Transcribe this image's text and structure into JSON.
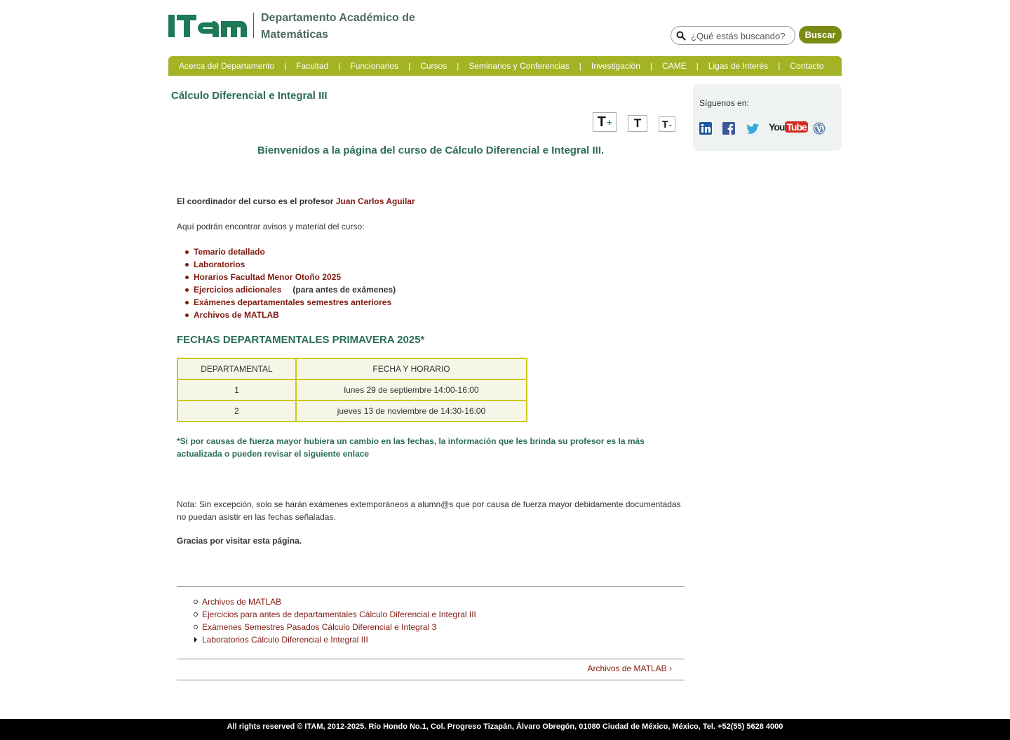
{
  "header": {
    "logo_text": "ITAM",
    "dept_line1": "Departamento Académico de",
    "dept_line2": "Matemáticas",
    "search_placeholder": "¿Qué estás buscando?",
    "search_button": "Buscar"
  },
  "nav": {
    "items": [
      {
        "label": "Acerca del Departamento"
      },
      {
        "label": "Facultad"
      },
      {
        "label": "Funcionarios"
      },
      {
        "label": "Cursos"
      },
      {
        "label": "Seminarios y Conferencias"
      },
      {
        "label": "Investigación"
      },
      {
        "label": "CAME"
      },
      {
        "label": "Ligas de Interés"
      },
      {
        "label": "Contacto"
      }
    ]
  },
  "main": {
    "title": "Cálculo Diferencial e Integral III",
    "text_size": {
      "increase": "T",
      "increase_symbol": "+",
      "reset": "T",
      "decrease": "T",
      "decrease_symbol": "-"
    },
    "welcome": "Bienvenidos a la página del curso de Cálculo Diferencial e Integral III.",
    "coordinator_prefix": "El coordinador del curso es el profesor",
    "coordinator_name": "Juan Carlos Aguilar",
    "intro": "Aquí podrán encontrar  avisos y material del curso:",
    "links": [
      {
        "label": "Temario detallado",
        "suffix": ""
      },
      {
        "label": "Laboratorios",
        "suffix": ""
      },
      {
        "label": "Horarios Facultad Menor Otoño 2025",
        "suffix": ""
      },
      {
        "label": "Ejercicios adicionales",
        "suffix": "(para antes de exámenes)"
      },
      {
        "label": "Exámenes departamentales semestres anteriores",
        "suffix": ""
      },
      {
        "label": "Archivos de MATLAB",
        "suffix": ""
      }
    ],
    "dates_title": "FECHAS DEPARTAMENTALES PRIMAVERA 2025*",
    "table": {
      "headers": [
        "DEPARTAMENTAL",
        "FECHA Y HORARIO"
      ],
      "rows": [
        [
          "1",
          "lunes 29 de septiembre 14:00-16:00"
        ],
        [
          "2",
          "jueves 13 de noviembre de 14:30-16:00"
        ]
      ]
    },
    "note_green": "*Si por causas de fuerza mayor hubiera un cambio en las fechas, la información que les brinda su profesor es la más actualizada o pueden revisar el siguiente enlace",
    "nota": "Nota: Sin excepción, solo se harán exámenes extemporáneos a alumn@s que por causa de fuerza mayor debidamente documentadas no puedan asistir en las fechas señaladas.",
    "gracias": "Gracias por visitar esta página.",
    "book_nav": [
      "Archivos de MATLAB",
      "Ejercicios para antes de departamentales Cálculo Diferencial e Integral III",
      "Exámenes Semestres Pasados Cálculo Diferencial e Integral 3",
      "Laboratorios Cálculo Diferencial e Integral III"
    ],
    "next_link": "Archivos de MATLAB ›"
  },
  "sidebar": {
    "follow_label": "Síguenos en:",
    "social_icons": [
      "linkedin-icon",
      "facebook-icon",
      "twitter-icon",
      "youtube-icon",
      "wordpress-icon"
    ],
    "youtube_you": "You",
    "youtube_tube": "Tube"
  },
  "footer": {
    "text": "All rights reserved © ITAM, 2012-2025. Río Hondo No.1, Col. Progreso Tizapán, Álvaro Obregón, 01080 Ciudad de México, México, Tel. +52(55) 5628 4000"
  },
  "colors": {
    "nav_green": "#a3b324",
    "title_green": "#2b6e53",
    "link_maroon": "#7f1a10",
    "button_olive": "#7a8a12",
    "table_border": "#ccc91a"
  }
}
